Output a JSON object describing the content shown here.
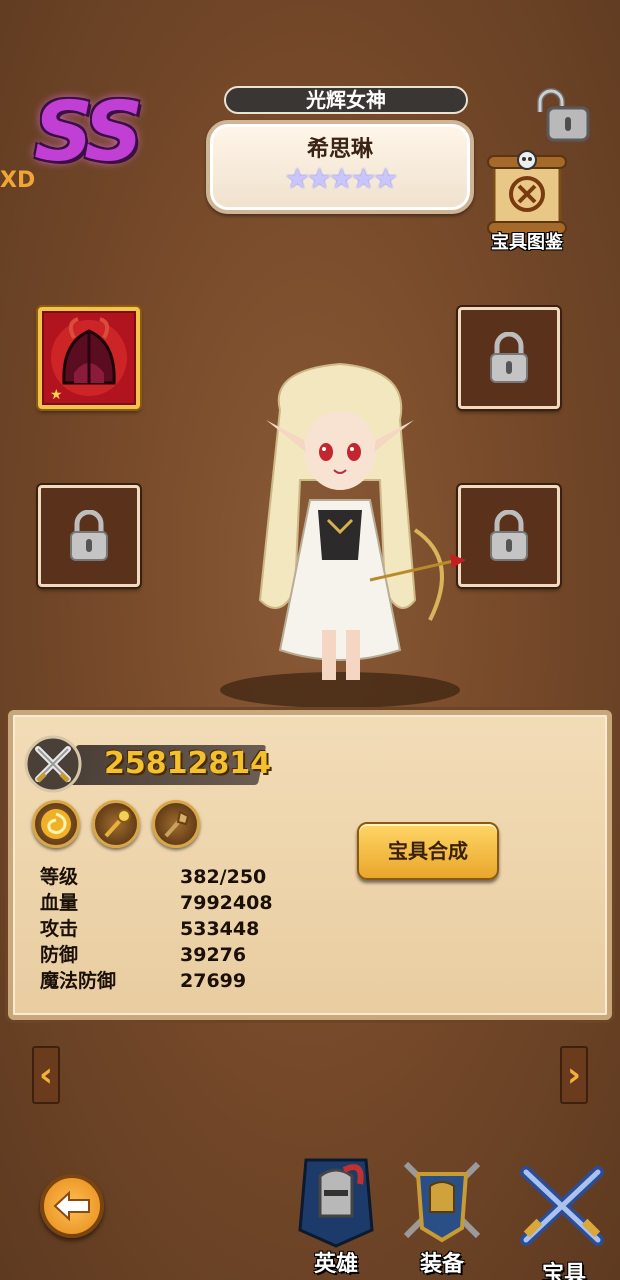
{
  "header": {
    "rank": "SS",
    "side_tag": "XD",
    "title": "光辉女神",
    "hero_name": "希思琳",
    "stars": "★★★★★",
    "handbook_label": "宝具图鉴"
  },
  "power": {
    "value": "25812814"
  },
  "actions": {
    "merge_label": "宝具合成"
  },
  "stats": {
    "level_label": "等级",
    "level_value": "382/250",
    "hp_label": "血量",
    "hp_value": "7992408",
    "atk_label": "攻击",
    "atk_value": "533448",
    "def_label": "防御",
    "def_value": "39276",
    "mdef_label": "魔法防御",
    "mdef_value": "27699"
  },
  "nav": {
    "prev": "‹",
    "next": "›"
  },
  "tabs": {
    "hero": "英雄",
    "equipment": "装备",
    "artifact": "宝具"
  },
  "colors": {
    "rank": "#c23fd6",
    "power": "#f3c12d",
    "button": "#f0b445",
    "background": "#774a2a"
  }
}
